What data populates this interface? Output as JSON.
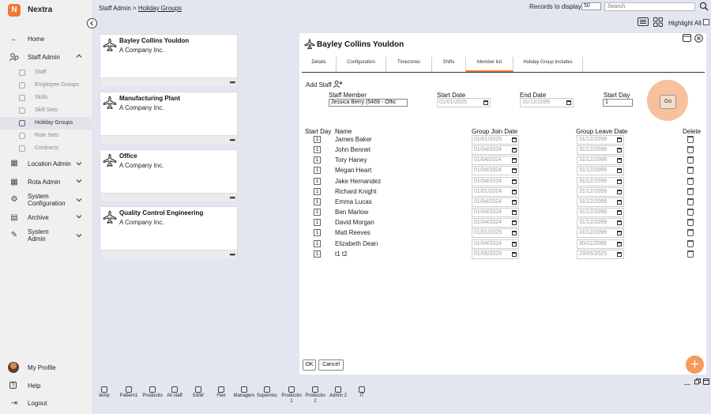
{
  "app": {
    "name": "Nextra",
    "logo_letter": "N",
    "accent": "#f07a32"
  },
  "sidebar": {
    "home": "Home",
    "staff_admin": "Staff Admin",
    "sub_items": [
      "Staff",
      "Employee Groups",
      "Skills",
      "Skill Sets",
      "Holiday Groups",
      "Role Sets",
      "Contracts"
    ],
    "active_sub": "Holiday Groups",
    "sections": [
      {
        "label": "Location Admin",
        "icon": "building-icon"
      },
      {
        "label": "Rota Admin",
        "icon": "grid-icon"
      },
      {
        "label": "System Configuration",
        "icon": "gear-icon"
      },
      {
        "label": "Archive",
        "icon": "archive-icon"
      },
      {
        "label": "System Admin",
        "icon": "wrench-icon"
      }
    ],
    "bottom": {
      "profile": "My Profile",
      "help": "Help",
      "logout": "Logout"
    }
  },
  "topbar": {
    "breadcrumb_root": "Staff Admin",
    "breadcrumb_sep": ">",
    "breadcrumb_current": "Holiday Groups",
    "records_label": "Records to display",
    "records_value": "50",
    "search_placeholder": "Search",
    "highlight_all": "Highlight All"
  },
  "groups": [
    {
      "name": "Bayley Collins Youldon",
      "company": "A Company Inc."
    },
    {
      "name": "Manufacturing Plant",
      "company": "A Company Inc."
    },
    {
      "name": "Office",
      "company": "A Company Inc."
    },
    {
      "name": "Quality Control Engineering",
      "company": "A Company Inc."
    }
  ],
  "more_label": "•••",
  "detail": {
    "title": "Bayley Collins Youldon",
    "tabs": [
      "Details",
      "Configuration",
      "Timezones",
      "Shifts",
      "Member list",
      "Holiday Group Includes"
    ],
    "active_tab": "Member list",
    "add_staff": "Add Staff",
    "staff_member_label": "Staff Member",
    "staff_member_value": "Jessica Berry (5469 - Offic",
    "start_date_label": "Start Date",
    "start_date_value": "01/01/2025",
    "end_date_label": "End Date",
    "end_date_value": "31/12/2099",
    "start_day_label": "Start Day",
    "start_day_value": "1",
    "go": "Go",
    "columns": {
      "start_day": "Start Day",
      "name": "Name",
      "join": "Group Join Date",
      "leave": "Group Leave Date",
      "delete": "Delete"
    },
    "members": [
      {
        "day": "1",
        "name": "James Baker",
        "join": "01/01/2025",
        "leave": "31/12/2099"
      },
      {
        "day": "1",
        "name": "John Bennet",
        "join": "01/04/2024",
        "leave": "31/12/2099"
      },
      {
        "day": "1",
        "name": "Tory Haney",
        "join": "01/04/2024",
        "leave": "31/12/2099"
      },
      {
        "day": "1",
        "name": "Megan Heart",
        "join": "01/04/2024",
        "leave": "31/12/2099"
      },
      {
        "day": "1",
        "name": "Jake Hernandez",
        "join": "01/04/2024",
        "leave": "31/12/2099"
      },
      {
        "day": "1",
        "name": "Richard Knight",
        "join": "01/01/2024",
        "leave": "31/12/2099"
      },
      {
        "day": "1",
        "name": "Emma Lucas",
        "join": "01/04/2024",
        "leave": "31/12/2099"
      },
      {
        "day": "1",
        "name": "Ben Marlow",
        "join": "01/04/2024",
        "leave": "31/12/2099"
      },
      {
        "day": "1",
        "name": "David Morgan",
        "join": "01/04/2024",
        "leave": "31/12/2099"
      },
      {
        "day": "1",
        "name": "Matt Reeves",
        "join": "01/01/2025",
        "leave": "31/12/2099"
      },
      {
        "day": "1",
        "name": "Elizabeth Dean",
        "join": "01/04/2024",
        "leave": "30/11/2099"
      },
      {
        "day": "1",
        "name": "t1 t2",
        "join": "01/05/2025",
        "leave": "23/05/2025"
      }
    ],
    "ok": "OK",
    "cancel": "Cancel"
  },
  "fab_label": "+",
  "bottom_bar": [
    {
      "l1": "temp",
      "l2": ""
    },
    {
      "l1": "Pattern1",
      "l2": ""
    },
    {
      "l1": "Productio",
      "l2": ""
    },
    {
      "l1": "All staff",
      "l2": ""
    },
    {
      "l1": "E&W",
      "l2": ""
    },
    {
      "l1": "Flex",
      "l2": ""
    },
    {
      "l1": "Managers",
      "l2": ""
    },
    {
      "l1": "Supervisc",
      "l2": ""
    },
    {
      "l1": "Productio",
      "l2": "1"
    },
    {
      "l1": "Productio",
      "l2": "2"
    },
    {
      "l1": "Admin 2",
      "l2": ""
    },
    {
      "l1": "IT",
      "l2": ""
    }
  ]
}
